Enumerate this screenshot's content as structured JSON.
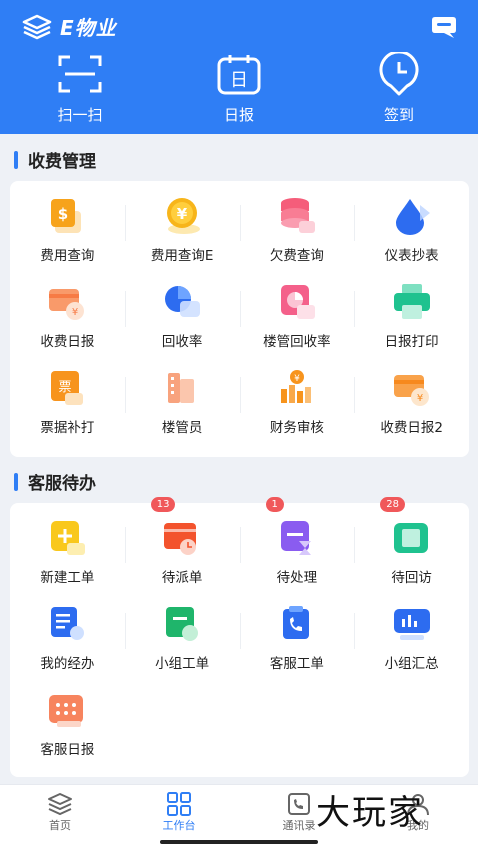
{
  "app": {
    "title": "E物业"
  },
  "quick_actions": [
    {
      "label": "扫一扫",
      "icon": "scan-icon"
    },
    {
      "label": "日报",
      "icon": "calendar-icon"
    },
    {
      "label": "签到",
      "icon": "clock-pin-icon"
    }
  ],
  "sections": {
    "fee": {
      "title": "收费管理",
      "items": [
        {
          "label": "费用查询",
          "icon": "dollar-doc-icon"
        },
        {
          "label": "费用查询E",
          "icon": "yen-coin-icon"
        },
        {
          "label": "欠费查询",
          "icon": "database-stack-icon"
        },
        {
          "label": "仪表抄表",
          "icon": "water-drop-icon"
        },
        {
          "label": "收费日报",
          "icon": "card-yen-icon"
        },
        {
          "label": "回收率",
          "icon": "pie-chart-icon"
        },
        {
          "label": "楼管回收率",
          "icon": "pie-card-icon"
        },
        {
          "label": "日报打印",
          "icon": "printer-icon"
        },
        {
          "label": "票据补打",
          "icon": "ticket-icon"
        },
        {
          "label": "楼管员",
          "icon": "building-icon"
        },
        {
          "label": "财务审核",
          "icon": "bar-audit-icon"
        },
        {
          "label": "收费日报2",
          "icon": "card-yen-icon"
        }
      ]
    },
    "service": {
      "title": "客服待办",
      "items": [
        {
          "label": "新建工单",
          "icon": "plus-doc-icon",
          "badge": ""
        },
        {
          "label": "待派单",
          "icon": "dispatch-icon",
          "badge": "13"
        },
        {
          "label": "待处理",
          "icon": "hourglass-icon",
          "badge": "1"
        },
        {
          "label": "待回访",
          "icon": "revisit-icon",
          "badge": "28"
        },
        {
          "label": "我的经办",
          "icon": "my-doc-icon",
          "badge": ""
        },
        {
          "label": "小组工单",
          "icon": "group-doc-icon",
          "badge": ""
        },
        {
          "label": "客服工单",
          "icon": "phone-doc-icon",
          "badge": ""
        },
        {
          "label": "小组汇总",
          "icon": "summary-chart-icon",
          "badge": ""
        },
        {
          "label": "客服日报",
          "icon": "calendar-grid-icon",
          "badge": ""
        }
      ]
    }
  },
  "tabs": [
    {
      "label": "首页",
      "icon": "home-stack-icon",
      "active": false
    },
    {
      "label": "工作台",
      "icon": "grid-icon",
      "active": true
    },
    {
      "label": "通讯录",
      "icon": "contacts-icon",
      "active": false
    },
    {
      "label": "我的",
      "icon": "user-icon",
      "active": false
    }
  ],
  "watermark": "大玩家",
  "colors": {
    "primary": "#2f7ef5",
    "badge": "#f0585a"
  }
}
